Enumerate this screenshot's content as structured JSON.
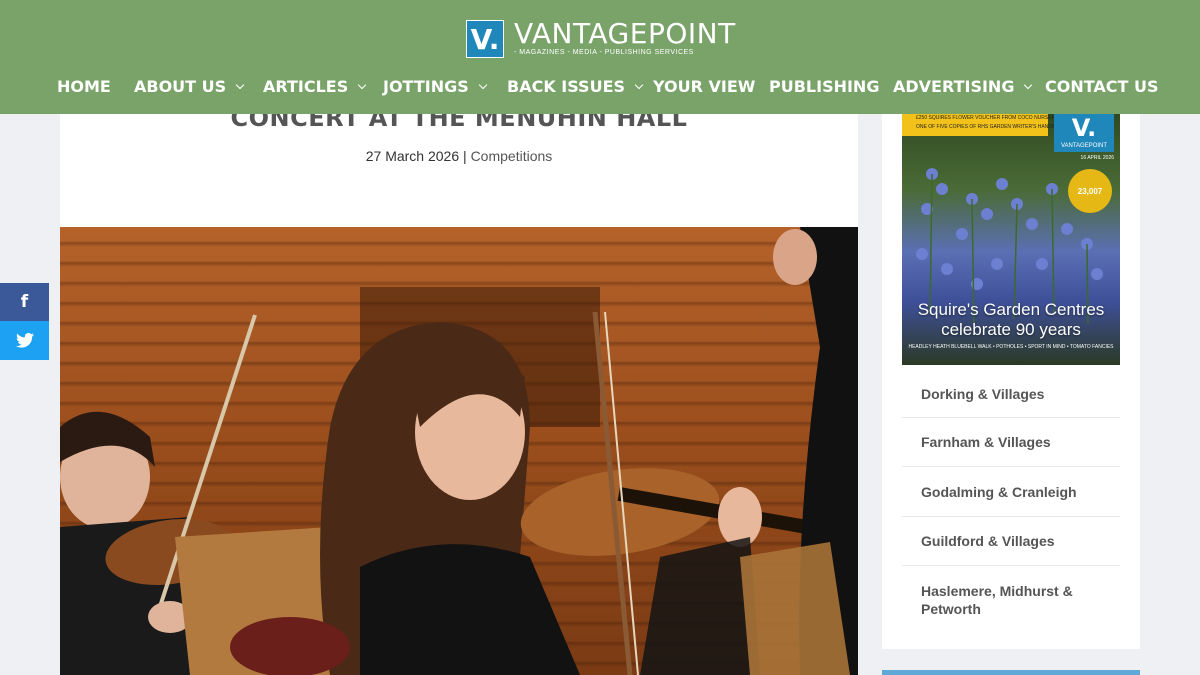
{
  "brand": {
    "logo_letter": "V.",
    "name": "VANTAGEPOINT",
    "tagline": "- MAGAZINES - MEDIA - PUBLISHING SERVICES"
  },
  "nav": [
    {
      "label": "HOME",
      "dropdown": false
    },
    {
      "label": "ABOUT US",
      "dropdown": true
    },
    {
      "label": "ARTICLES",
      "dropdown": true
    },
    {
      "label": "JOTTINGS",
      "dropdown": true
    },
    {
      "label": "BACK ISSUES",
      "dropdown": true
    },
    {
      "label": "YOUR VIEW",
      "dropdown": false
    },
    {
      "label": "PUBLISHING",
      "dropdown": false
    },
    {
      "label": "ADVERTISING",
      "dropdown": true
    },
    {
      "label": "CONTACT US",
      "dropdown": false
    }
  ],
  "post": {
    "title": "CONCERT AT THE MENUHIN HALL",
    "date": "27 March 2026",
    "separator": " | ",
    "category": "Competitions"
  },
  "social": {
    "facebook_glyph": "f",
    "facebook_icon": "facebook-icon",
    "twitter_icon": "twitter-icon"
  },
  "sidebar": {
    "cover": {
      "banner_lines": [
        "£250 SQUIRES FLOWER VOUCHER FROM COCO NURSERY",
        "ONE OF FIVE COPIES OF RHS GARDEN WRITER'S HANDBOOK 2026"
      ],
      "logo_letter": "V.",
      "logo_name": "VANTAGEPOINT",
      "issue": "16 APRIL 2026",
      "badge": "23,007",
      "headline_line1": "Squire's Garden Centres",
      "headline_line2": "celebrate 90 years",
      "strap": "HEADLEY HEATH BLUEBELL WALK • POTHOLES • SPORT IN MIND • TOMATO FANCIES"
    },
    "links": [
      "Dorking & Villages",
      "Farnham & Villages",
      "Godalming & Cranleigh",
      "Guildford & Villages",
      "Haslemere, Midhurst & Petworth"
    ]
  },
  "colors": {
    "header_bg": "#7aa36a",
    "logo_blue": "#1f87b9",
    "facebook": "#3b5998",
    "twitter": "#1da1f2"
  }
}
